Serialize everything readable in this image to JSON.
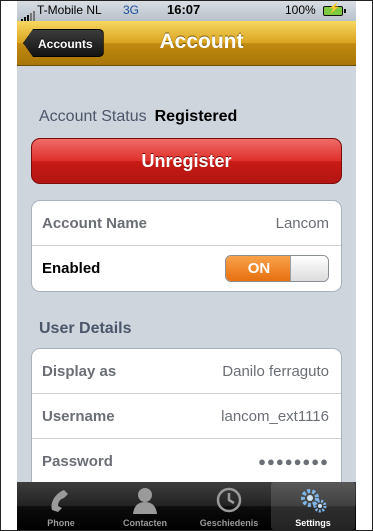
{
  "status_bar": {
    "carrier": "T-Mobile NL",
    "network": "3G",
    "time": "16:07",
    "battery": "100%"
  },
  "nav": {
    "back_label": "Accounts",
    "title": "Account"
  },
  "account_status": {
    "label": "Account Status",
    "value": "Registered"
  },
  "unregister_label": "Unregister",
  "account_group": {
    "name_label": "Account Name",
    "name_value": "Lancom",
    "enabled_label": "Enabled",
    "enabled_toggle": "ON"
  },
  "user_details": {
    "header": "User Details",
    "display_label": "Display as",
    "display_value": "Danilo ferraguto",
    "username_label": "Username",
    "username_value": "lancom_ext1116",
    "password_label": "Password",
    "password_value": "●●●●●●●●"
  },
  "tabs": [
    {
      "label": "Phone",
      "icon": "phone-icon"
    },
    {
      "label": "Contacten",
      "icon": "contacts-icon"
    },
    {
      "label": "Geschiedenis",
      "icon": "clock-icon"
    },
    {
      "label": "Settings",
      "icon": "gear-icon"
    }
  ],
  "colors": {
    "nav_bar": "#d9a320",
    "unregister": "#de2f2a",
    "toggle_on": "#e6700f"
  }
}
